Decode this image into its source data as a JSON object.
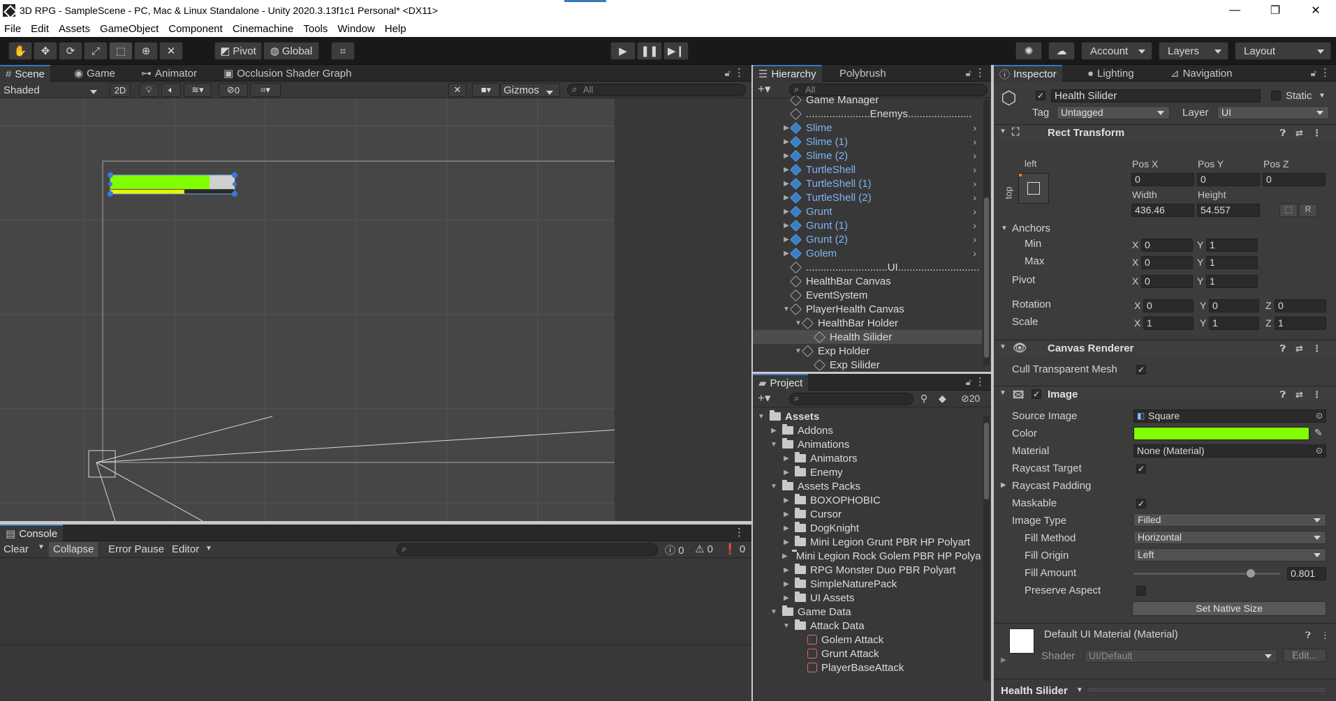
{
  "window": {
    "title": "3D RPG - SampleScene - PC, Mac & Linux Standalone - Unity 2020.3.13f1c1 Personal* <DX11>",
    "minimize": "—",
    "restore": "❐",
    "close": "✕"
  },
  "menu": [
    "File",
    "Edit",
    "Assets",
    "GameObject",
    "Component",
    "Cinemachine",
    "Tools",
    "Window",
    "Help"
  ],
  "toolbar": {
    "pivot": "Pivot",
    "global": "Global",
    "account": "Account",
    "layers": "Layers",
    "layout": "Layout"
  },
  "scene": {
    "tabs": [
      "Scene",
      "Game",
      "Animator",
      "Occlusion Shader Graph"
    ],
    "shading": "Shaded",
    "mode2d": "2D",
    "hidden_count": "0",
    "gizmos": "Gizmos",
    "search_placeholder": "All"
  },
  "hierarchy": {
    "tabs": [
      "Hierarchy",
      "Polybrush"
    ],
    "search_placeholder": "All",
    "items": [
      {
        "label": "Game Manager",
        "kind": "plain",
        "depth": 0
      },
      {
        "label": "......................Enemys......................",
        "kind": "plain",
        "depth": 0
      },
      {
        "label": "Slime",
        "kind": "prefab",
        "depth": 0
      },
      {
        "label": "Slime (1)",
        "kind": "prefab",
        "depth": 0
      },
      {
        "label": "Slime (2)",
        "kind": "prefab",
        "depth": 0
      },
      {
        "label": "TurtleShell",
        "kind": "prefab",
        "depth": 0
      },
      {
        "label": "TurtleShell (1)",
        "kind": "prefab",
        "depth": 0
      },
      {
        "label": "TurtleShell (2)",
        "kind": "prefab",
        "depth": 0
      },
      {
        "label": "Grunt",
        "kind": "prefab",
        "depth": 0
      },
      {
        "label": "Grunt (1)",
        "kind": "prefab",
        "depth": 0
      },
      {
        "label": "Grunt (2)",
        "kind": "prefab",
        "depth": 0
      },
      {
        "label": "Golem",
        "kind": "prefab",
        "depth": 0
      },
      {
        "label": "............................UI............................",
        "kind": "plain",
        "depth": 0
      },
      {
        "label": "HealthBar Canvas",
        "kind": "plain",
        "depth": 0
      },
      {
        "label": "EventSystem",
        "kind": "plain",
        "depth": 0
      },
      {
        "label": "PlayerHealth Canvas",
        "kind": "expanded",
        "depth": 0
      },
      {
        "label": "HealthBar Holder",
        "kind": "expanded",
        "depth": 1
      },
      {
        "label": "Health Silider",
        "kind": "selected",
        "depth": 2
      },
      {
        "label": "Exp Holder",
        "kind": "expanded",
        "depth": 1
      },
      {
        "label": "Exp Silider",
        "kind": "plain",
        "depth": 2
      }
    ]
  },
  "project": {
    "tab": "Project",
    "hidden_count": "20",
    "items": [
      {
        "label": "Assets",
        "depth": 0,
        "open": true,
        "bold": true
      },
      {
        "label": "Addons",
        "depth": 1,
        "open": false
      },
      {
        "label": "Animations",
        "depth": 1,
        "open": true
      },
      {
        "label": "Animators",
        "depth": 2,
        "open": false
      },
      {
        "label": "Enemy",
        "depth": 2,
        "open": false
      },
      {
        "label": "Assets Packs",
        "depth": 1,
        "open": true
      },
      {
        "label": "BOXOPHOBIC",
        "depth": 2,
        "open": false
      },
      {
        "label": "Cursor",
        "depth": 2,
        "open": false
      },
      {
        "label": "DogKnight",
        "depth": 2,
        "open": false
      },
      {
        "label": "Mini Legion Grunt PBR HP Polyart",
        "depth": 2,
        "open": false
      },
      {
        "label": "Mini Legion Rock Golem PBR HP Polyart",
        "depth": 2,
        "open": false
      },
      {
        "label": "RPG Monster Duo PBR Polyart",
        "depth": 2,
        "open": false
      },
      {
        "label": "SimpleNaturePack",
        "depth": 2,
        "open": false
      },
      {
        "label": "UI Assets",
        "depth": 2,
        "open": false
      },
      {
        "label": "Game Data",
        "depth": 1,
        "open": true
      },
      {
        "label": "Attack Data",
        "depth": 2,
        "open": true
      },
      {
        "label": "Golem Attack",
        "depth": 3,
        "asset": true
      },
      {
        "label": "Grunt Attack",
        "depth": 3,
        "asset": true
      },
      {
        "label": "PlayerBaseAttack",
        "depth": 3,
        "asset": true
      }
    ]
  },
  "console": {
    "tab": "Console",
    "clear": "Clear",
    "collapse": "Collapse",
    "error_pause": "Error Pause",
    "editor": "Editor",
    "info_count": "0",
    "warn_count": "0",
    "error_count": "0"
  },
  "inspector": {
    "tabs": [
      "Inspector",
      "Lighting",
      "Navigation"
    ],
    "object_name": "Health Silider",
    "static_label": "Static",
    "tag_label": "Tag",
    "tag_value": "Untagged",
    "layer_label": "Layer",
    "layer_value": "UI",
    "rect_transform": {
      "title": "Rect Transform",
      "anchor_h": "left",
      "anchor_v": "top",
      "pos_x_label": "Pos X",
      "pos_y_label": "Pos Y",
      "pos_z_label": "Pos Z",
      "pos_x": "0",
      "pos_y": "0",
      "pos_z": "0",
      "width_label": "Width",
      "height_label": "Height",
      "width": "436.46",
      "height": "54.557",
      "r_button": "R",
      "anchors_label": "Anchors",
      "min_label": "Min",
      "min_x": "0",
      "min_y": "1",
      "max_label": "Max",
      "max_x": "0",
      "max_y": "1",
      "pivot_label": "Pivot",
      "pivot_x": "0",
      "pivot_y": "1",
      "rotation_label": "Rotation",
      "rot_x": "0",
      "rot_y": "0",
      "rot_z": "0",
      "scale_label": "Scale",
      "scale_x": "1",
      "scale_y": "1",
      "scale_z": "1"
    },
    "canvas_renderer": {
      "title": "Canvas Renderer",
      "cull_label": "Cull Transparent Mesh"
    },
    "image": {
      "title": "Image",
      "source_image_label": "Source Image",
      "source_image": "Square",
      "color_label": "Color",
      "color": "#80ff00",
      "material_label": "Material",
      "material": "None (Material)",
      "raycast_target_label": "Raycast Target",
      "raycast_padding_label": "Raycast Padding",
      "maskable_label": "Maskable",
      "image_type_label": "Image Type",
      "image_type": "Filled",
      "fill_method_label": "Fill Method",
      "fill_method": "Horizontal",
      "fill_origin_label": "Fill Origin",
      "fill_origin": "Left",
      "fill_amount_label": "Fill Amount",
      "fill_amount": "0.801",
      "preserve_aspect_label": "Preserve Aspect",
      "set_native_size": "Set Native Size"
    },
    "material_block": {
      "title": "Default UI Material (Material)",
      "shader_label": "Shader",
      "shader": "UI/Default",
      "edit": "Edit..."
    },
    "footer_label": "Health Silider"
  }
}
